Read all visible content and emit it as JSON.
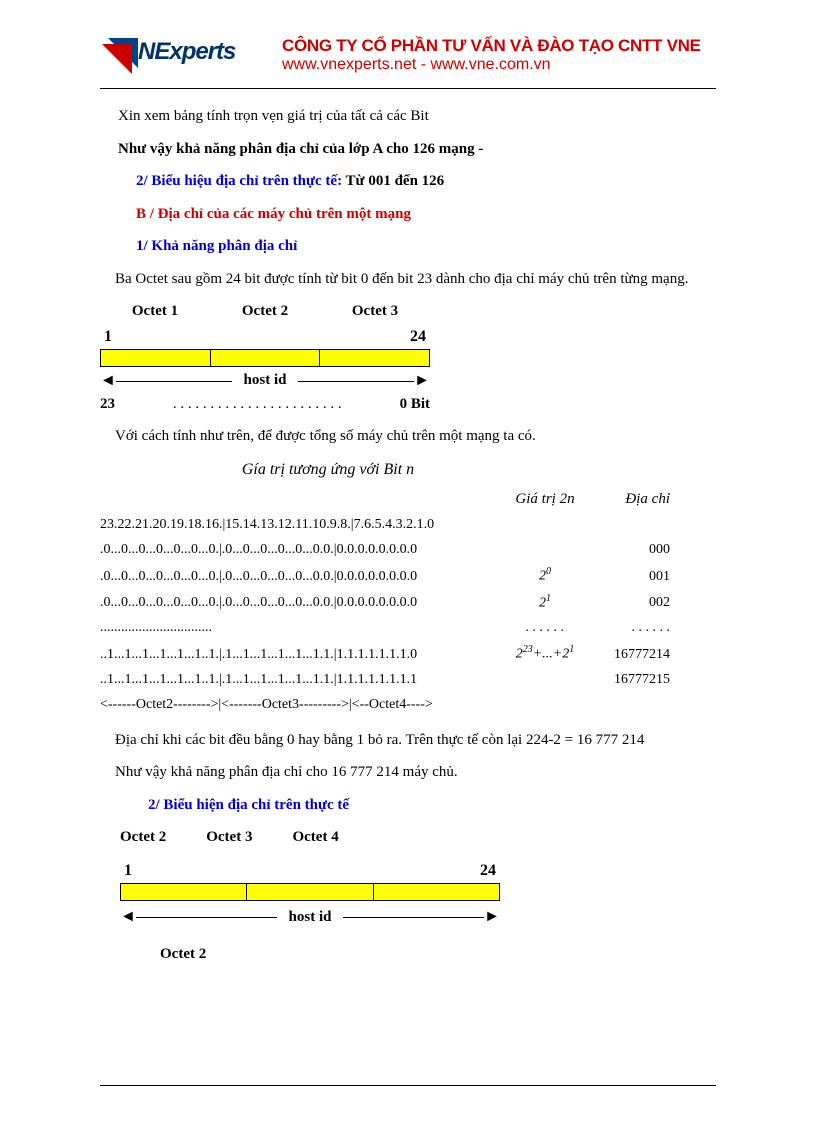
{
  "header": {
    "logo_text": "NExperts",
    "company_name": "CÔNG TY CỔ PHẦN TƯ VẤN VÀ ĐÀO TẠO CNTT VNE",
    "urls": "www.vnexperts.net - www.vne.com.vn"
  },
  "body": {
    "p1": "Xin xem bảng tính trọn vẹn giá trị của tất cả các Bit",
    "p2": "Như vậy khả năng phân địa chỉ của lớp A cho 126 mạng -",
    "p3_a": "2/ Biểu hiệu địa chỉ trên thực tế:",
    "p3_b": " Từ 001 đến 126",
    "p4": "B / Địa chỉ của các máy chủ trên một mạng",
    "p5": "1/ Khả năng phân địa chỉ",
    "p6": "Ba Octet sau gồm 24 bit được tính từ bit 0 đến bit 23 dành cho địa chỉ máy chủ trên từng mạng.",
    "diagram1": {
      "labels": [
        "Octet 1",
        "Octet 2",
        "Octet 3"
      ],
      "top_left": "1",
      "top_right": "24",
      "mid_label": "host id",
      "bot_left": "23",
      "bot_right": "0 Bit",
      "dots": " .  .  .  .  .  .  .  .  .  .  .  .  .  .  .  .  .  .  .  .  .  .  . "
    },
    "p7": "Với cách tính như trên, để được tổng số máy chủ trên một mạng ta có.",
    "table": {
      "title": "Gía trị tương ứng với Bit n",
      "h2": "Giá  trị 2n",
      "h3": "Địa chỉ",
      "rows": [
        {
          "c1": "23.22.21.20.19.18.16.|15.14.13.12.11.10.9.8.|7.6.5.4.3.2.1.0",
          "c2": "",
          "c3": ""
        },
        {
          "c1": ".0...0...0...0...0...0...0.|.0...0...0...0...0...0.0.|0.0.0.0.0.0.0.0",
          "c2": "",
          "c3": "000"
        },
        {
          "c1": ".0...0...0...0...0...0...0.|.0...0...0...0...0...0.0.|0.0.0.0.0.0.0.0",
          "c2_html": "2<sup>0</sup>",
          "c3": "001"
        },
        {
          "c1": ".0...0...0...0...0...0...0.|.0...0...0...0...0...0.0.|0.0.0.0.0.0.0.0",
          "c2_html": "2<sup>1</sup>",
          "c3": "002"
        },
        {
          "c1": "................................",
          "c2": ". . . . . .",
          "c3": ". . . . . ."
        },
        {
          "c1": "..1...1...1...1...1...1..1.|.1...1...1...1...1...1.1.|1.1.1.1.1.1.1.0",
          "c2_html": "2<sup>23</sup>+...+2<sup>1</sup>",
          "c3": "16777214"
        },
        {
          "c1": "..1...1...1...1...1...1..1.|.1...1...1...1...1...1.1.|1.1.1.1.1.1.1.1",
          "c2": "",
          "c3": "16777215"
        },
        {
          "c1": "<------Octet2-------->|<-------Octet3--------->|<--Octet4---->",
          "c2": "",
          "c3": ""
        }
      ]
    },
    "p8": "Địa chỉ khi các bit đều bằng 0 hay bằng 1 bỏ ra. Trên thực tế còn lại 224-2 = 16 777 214",
    "p9": "Như vậy khả năng phân địa chỉ cho 16 777 214 máy chủ.",
    "p10": "2/ Biểu hiện địa chỉ trên thực tế",
    "oct_row": [
      "Octet 2",
      "Octet 3",
      "Octet 4"
    ],
    "diagram2": {
      "top_left": "1",
      "top_right": "24",
      "mid_label": "host id"
    },
    "p11": "Octet 2"
  }
}
